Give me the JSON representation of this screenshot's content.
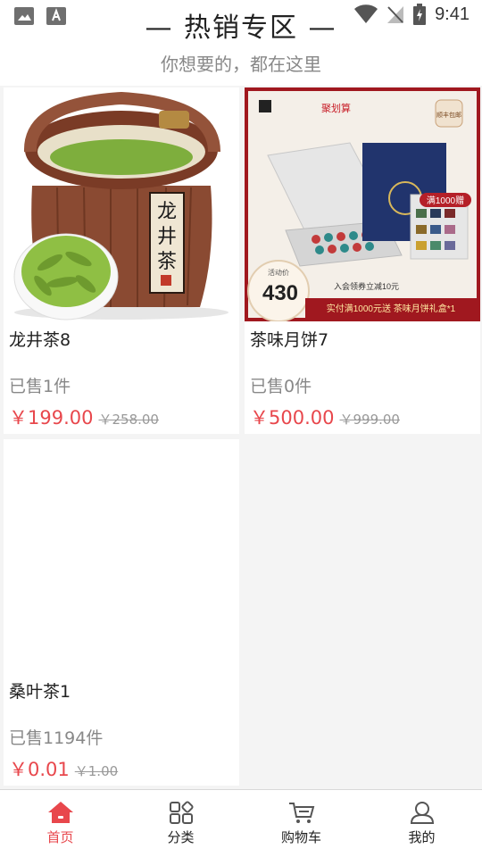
{
  "status_bar": {
    "time": "9:41"
  },
  "header": {
    "title": "— 热销专区 —",
    "subtitle": "你想要的，都在这里"
  },
  "products": [
    {
      "name": "龙井茶8",
      "sold": "已售1件",
      "price": "￥199.00",
      "original_price": "￥258.00",
      "image_text": [
        "龙",
        "井",
        "茶"
      ]
    },
    {
      "name": "茶味月饼7",
      "sold": "已售0件",
      "price": "￥500.00",
      "original_price": "￥999.00",
      "banner": {
        "brand": "聚划算",
        "badge": "顺丰包邮",
        "gift": "满1000赠",
        "price_tag": "活动价",
        "price_value": "430",
        "coupon": "入会领券立减10元",
        "promo": "实付满1000元送  茶味月饼礼盒*1"
      }
    },
    {
      "name": "桑叶茶1",
      "sold": "已售1194件",
      "price": "￥0.01",
      "original_price": "￥1.00"
    }
  ],
  "tabs": [
    {
      "label": "首页",
      "icon": "home-icon",
      "active": true
    },
    {
      "label": "分类",
      "icon": "category-icon",
      "active": false
    },
    {
      "label": "购物车",
      "icon": "cart-icon",
      "active": false
    },
    {
      "label": "我的",
      "icon": "profile-icon",
      "active": false
    }
  ],
  "colors": {
    "accent": "#e8474c",
    "muted": "#888888",
    "background": "#f4f4f4"
  }
}
